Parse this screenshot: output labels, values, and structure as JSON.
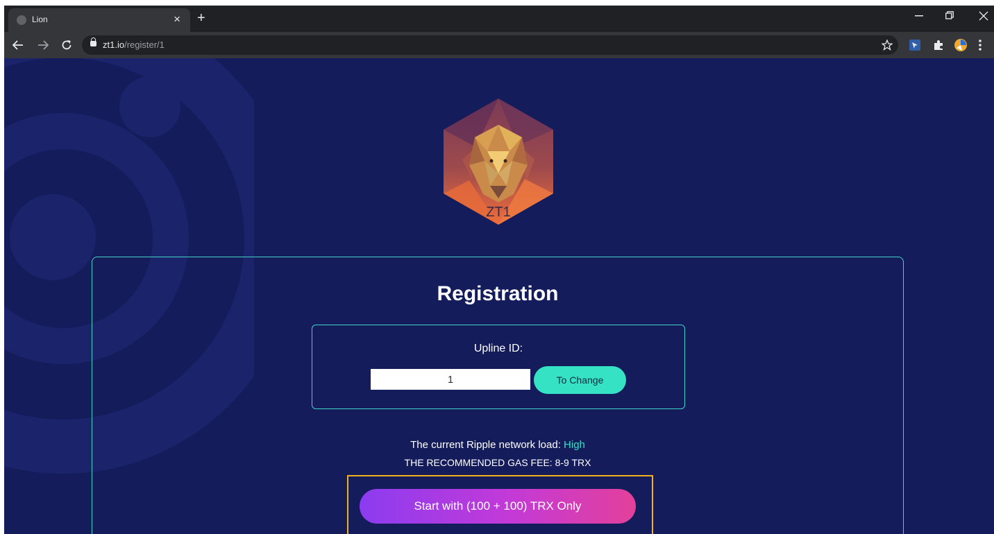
{
  "browser": {
    "tab_title": "Lion",
    "tab_close": "×",
    "new_tab": "+",
    "url_host": "zt1.io",
    "url_path": "/register/1",
    "colors": {
      "tabstrip": "#202124",
      "toolbar": "#35363a",
      "text": "#e8eaed"
    }
  },
  "page": {
    "logo_text": "ZT1",
    "title": "Registration",
    "upline": {
      "label": "Upline ID:",
      "value": "1",
      "button_label": "To Change"
    },
    "network": {
      "load_text": "The current Ripple network load: ",
      "load_level": "High",
      "gas_fee": "THE RECOMMENDED GAS FEE: 8-9 TRX"
    },
    "start_button_label": "Start with (100 + 100) TRX Only",
    "colors": {
      "background": "#141c5b",
      "accent": "#35e3c4",
      "panel_border": "#3fd4c6",
      "highlight": "#f3b21a",
      "gradient_start": "#8b3cf0",
      "gradient_end": "#e3409a"
    }
  }
}
